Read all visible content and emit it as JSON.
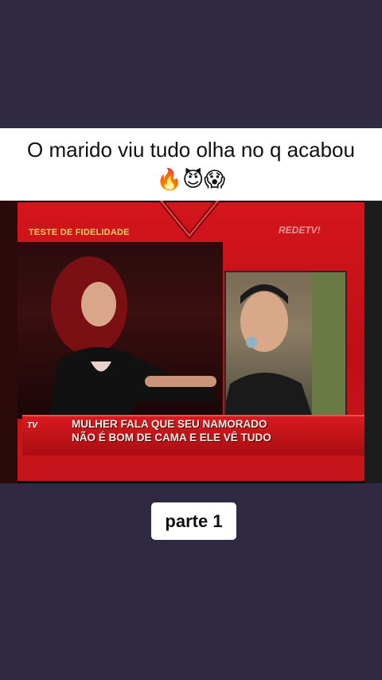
{
  "title": "O marido viu tudo olha no q acabou 🔥😈😱",
  "video": {
    "segment_label": "TESTE DE FIDELIDADE",
    "channel_bug": "REDETV!",
    "caption_line1": "MULHER FALA QUE SEU NAMORADO",
    "caption_line2": "NÃO É BOM DE CAMA E ELE VÊ TUDO",
    "corner_logo": "TV"
  },
  "part_label": "parte 1",
  "colors": {
    "background": "#2f2a41",
    "title_card": "#ffffff",
    "broadcast_red": "#d4151c"
  }
}
